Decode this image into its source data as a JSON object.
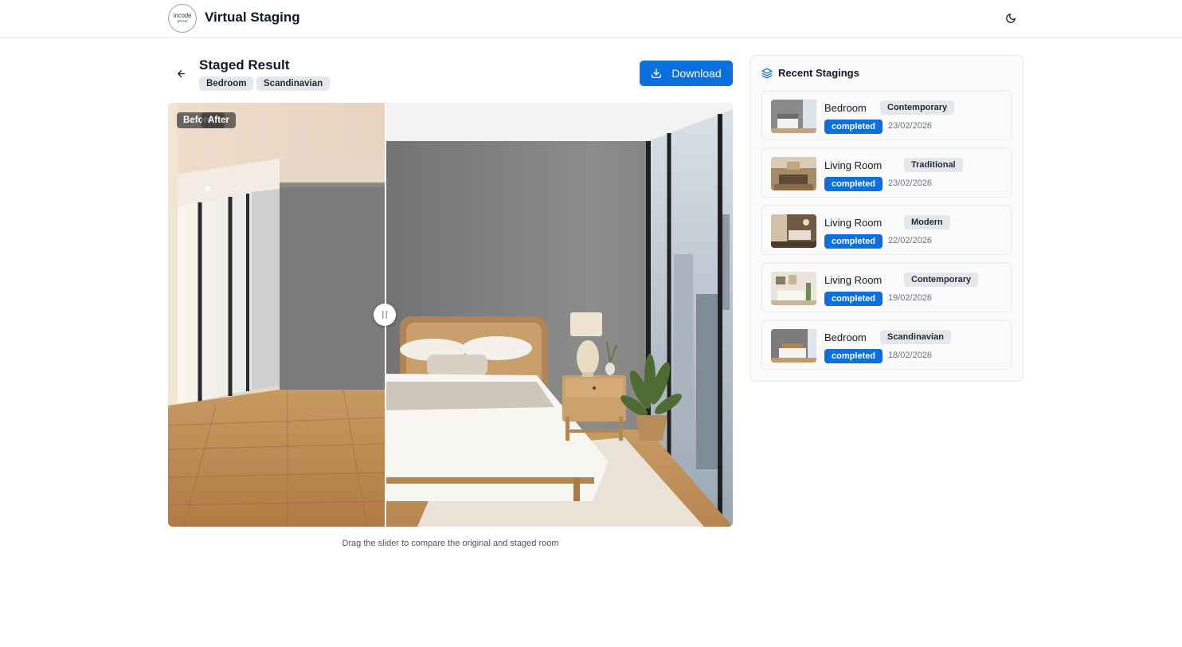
{
  "header": {
    "logo_text": "incode",
    "logo_subtext": "group",
    "app_title": "Virtual Staging",
    "theme_icon": "moon-icon"
  },
  "result": {
    "title": "Staged Result",
    "room": "Bedroom",
    "style": "Scandinavian",
    "download_label": "Download",
    "before_label": "Before",
    "after_label": "After",
    "slider_position_percent": 38.5,
    "hint": "Drag the slider to compare the original and staged room"
  },
  "recent": {
    "title": "Recent Stagings",
    "items": [
      {
        "room": "Bedroom",
        "style": "Contemporary",
        "status": "completed",
        "date": "23/02/2026"
      },
      {
        "room": "Living Room",
        "style": "Traditional",
        "status": "completed",
        "date": "23/02/2026"
      },
      {
        "room": "Living Room",
        "style": "Modern",
        "status": "completed",
        "date": "22/02/2026"
      },
      {
        "room": "Living Room",
        "style": "Contemporary",
        "status": "completed",
        "date": "19/02/2026"
      },
      {
        "room": "Bedroom",
        "style": "Scandinavian",
        "status": "completed",
        "date": "18/02/2026"
      }
    ]
  },
  "colors": {
    "accent": "#0b6fe0",
    "tag_bg": "#e5e7eb"
  }
}
